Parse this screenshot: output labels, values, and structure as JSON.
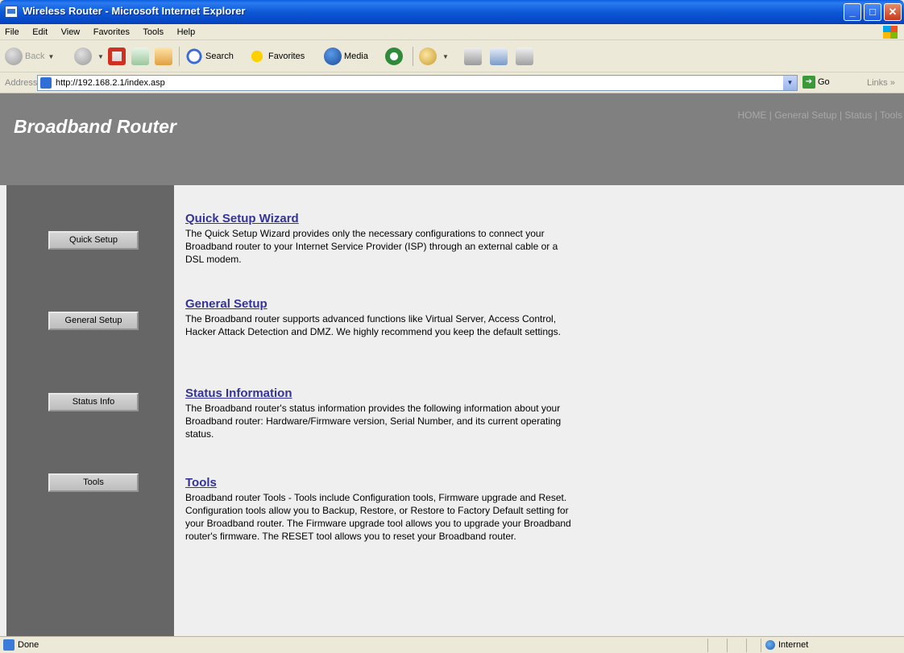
{
  "window": {
    "title": "Wireless Router - Microsoft Internet Explorer",
    "minimize": "_",
    "maximize": "□",
    "close": "✕"
  },
  "menubar": {
    "items": [
      "File",
      "Edit",
      "View",
      "Favorites",
      "Tools",
      "Help"
    ]
  },
  "toolbar": {
    "back": "Back",
    "search": "Search",
    "favorites": "Favorites",
    "media": "Media"
  },
  "addressbar": {
    "label": "Address",
    "url": "http://192.168.2.1/index.asp",
    "go": "Go",
    "links": "Links »"
  },
  "banner": {
    "brand": "Broadband Router",
    "nav": "HOME | General Setup | Status | Tools"
  },
  "sidebar": {
    "buttons": [
      "Quick Setup",
      "General Setup",
      "Status Info",
      "Tools"
    ]
  },
  "sections": [
    {
      "title": "Quick Setup Wizard",
      "text": "The Quick Setup Wizard provides only the necessary configurations to connect your Broadband router to your Internet Service Provider (ISP) through an external cable or a DSL modem."
    },
    {
      "title": "General Setup",
      "text": "The Broadband router supports advanced functions like Virtual Server, Access Control, Hacker Attack Detection and DMZ. We highly recommend you keep the default settings."
    },
    {
      "title": "Status Information",
      "text": "The Broadband router's status information provides the following information about your Broadband router: Hardware/Firmware version, Serial Number, and its current operating status."
    },
    {
      "title": "Tools",
      "text": "Broadband router Tools - Tools include Configuration tools, Firmware upgrade and Reset. Configuration tools allow you to Backup, Restore, or Restore to Factory Default setting for your Broadband router. The Firmware upgrade tool allows you to upgrade your Broadband router's firmware. The RESET tool allows you to reset your Broadband router."
    }
  ],
  "statusbar": {
    "status": "Done",
    "zone": "Internet"
  }
}
